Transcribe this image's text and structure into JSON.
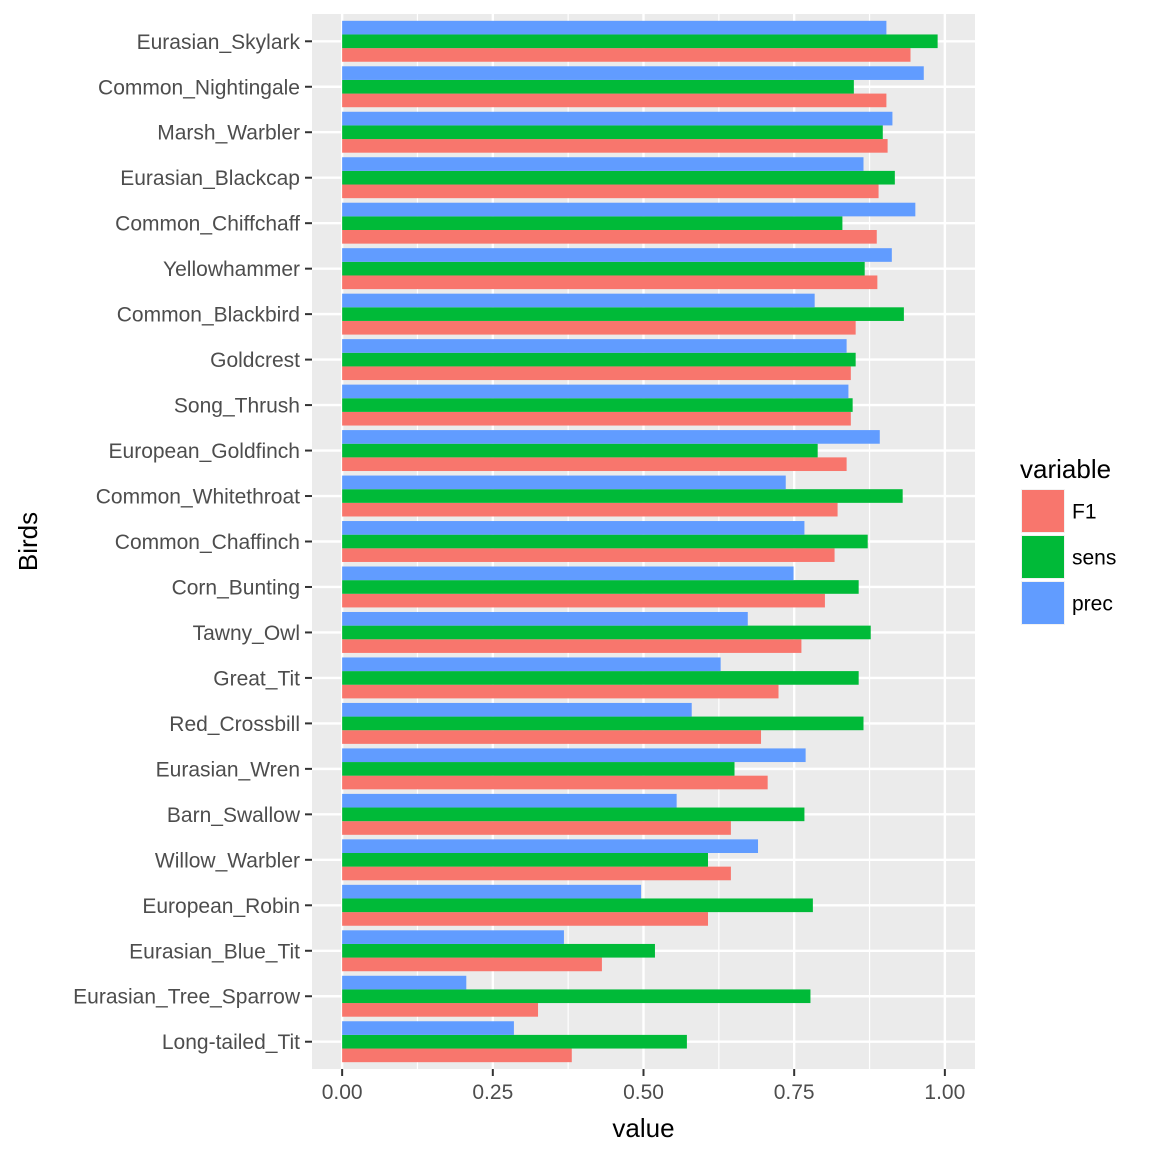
{
  "chart_data": {
    "type": "bar",
    "orientation": "horizontal",
    "position": "dodge",
    "title": "",
    "xlabel": "value",
    "ylabel": "Birds",
    "xlim": [
      -0.05,
      1.05
    ],
    "x_ticks": [
      0.0,
      0.25,
      0.5,
      0.75,
      1.0
    ],
    "x_tick_labels": [
      "0.00",
      "0.25",
      "0.50",
      "0.75",
      "1.00"
    ],
    "x_minor_ticks": [
      0.125,
      0.375,
      0.625,
      0.875
    ],
    "grid": true,
    "legend": {
      "title": "variable",
      "position": "right",
      "entries": [
        "F1",
        "sens",
        "prec"
      ]
    },
    "categories": [
      "Eurasian_Skylark",
      "Common_Nightingale",
      "Marsh_Warbler",
      "Eurasian_Blackcap",
      "Common_Chiffchaff",
      "Yellowhammer",
      "Common_Blackbird",
      "Goldcrest",
      "Song_Thrush",
      "European_Goldfinch",
      "Common_Whitethroat",
      "Common_Chaffinch",
      "Corn_Bunting",
      "Tawny_Owl",
      "Great_Tit",
      "Red_Crossbill",
      "Eurasian_Wren",
      "Barn_Swallow",
      "Willow_Warbler",
      "European_Robin",
      "Eurasian_Blue_Tit",
      "Eurasian_Tree_Sparrow",
      "Long-tailed_Tit"
    ],
    "series": [
      {
        "name": "F1",
        "color": "#F8766D",
        "values": [
          0.943,
          0.903,
          0.905,
          0.89,
          0.887,
          0.888,
          0.852,
          0.844,
          0.844,
          0.837,
          0.822,
          0.817,
          0.801,
          0.762,
          0.724,
          0.695,
          0.706,
          0.645,
          0.645,
          0.607,
          0.431,
          0.325,
          0.381
        ]
      },
      {
        "name": "sens",
        "color": "#00BA38",
        "values": [
          0.988,
          0.849,
          0.897,
          0.917,
          0.83,
          0.867,
          0.932,
          0.852,
          0.847,
          0.789,
          0.93,
          0.872,
          0.857,
          0.877,
          0.857,
          0.865,
          0.651,
          0.767,
          0.607,
          0.781,
          0.519,
          0.777,
          0.572
        ]
      },
      {
        "name": "prec",
        "color": "#619CFF",
        "values": [
          0.903,
          0.965,
          0.913,
          0.865,
          0.951,
          0.912,
          0.784,
          0.837,
          0.84,
          0.892,
          0.736,
          0.767,
          0.749,
          0.673,
          0.628,
          0.58,
          0.769,
          0.555,
          0.69,
          0.496,
          0.368,
          0.206,
          0.285
        ]
      }
    ]
  },
  "theme": {
    "panel_background": "#EBEBEB",
    "gridline_color": "#FFFFFF",
    "tick_color": "#333333"
  }
}
